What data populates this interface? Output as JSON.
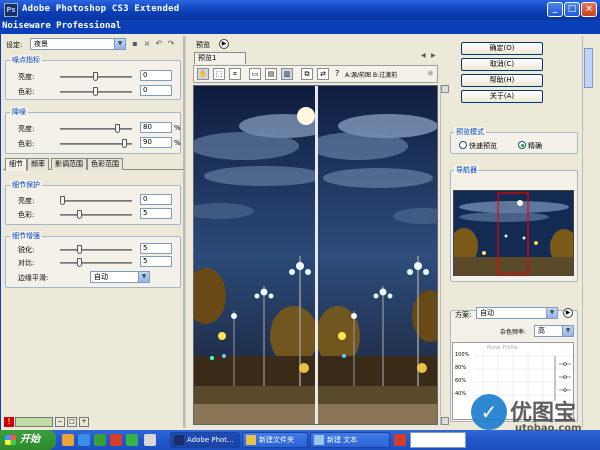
{
  "titlebar": {
    "icon": "Ps",
    "title": "Adobe Photoshop CS3 Extended",
    "minimize": "_",
    "maximize": "□",
    "close": "×"
  },
  "plugin_title": "Noiseware Professional",
  "settings": {
    "label": "设定:",
    "value": "夜景"
  },
  "brightness_group": {
    "title": "噪点指标",
    "luminance_label": "亮度:",
    "luminance_value": "0",
    "color_label": "色彩:",
    "color_value": "0"
  },
  "noise_reduction": {
    "title": "降噪",
    "luminance_label": "亮度:",
    "luminance_value": "80",
    "luminance_level": 0.8,
    "color_label": "色彩:",
    "color_value": "90",
    "color_level": 0.9,
    "unit": "%"
  },
  "tabs": [
    "细节",
    "频率",
    "影调范围",
    "色彩范围"
  ],
  "detail_protect": {
    "title": "细节保护",
    "luminance_label": "亮度:",
    "luminance_value": "0",
    "color_label": "色彩:",
    "color_value": "5"
  },
  "detail_enhance": {
    "title": "细节增强",
    "sharpen_label": "锐化:",
    "sharpen_value": "5",
    "contrast_label": "对比:",
    "contrast_value": "5",
    "smooth_label": "边缘平滑:",
    "smooth_value": "自动"
  },
  "preview": {
    "label": "预览",
    "tab": "预览1",
    "toolbar_text": "A:源/前图 B:过渡前",
    "help": "?"
  },
  "buttons": {
    "ok": "确定(O)",
    "cancel": "取消(C)",
    "help": "帮助(H)",
    "about": "关于(A)"
  },
  "preview_mode": {
    "title": "预览模式",
    "fast": "快速预览",
    "accurate": "精确",
    "selected": "accurate"
  },
  "navigator": {
    "title": "导航器"
  },
  "scheme": {
    "label": "方案:",
    "value": "自动",
    "sub_label": "杂色频率:",
    "sub_value": "高",
    "graph_title": "Noise Profile",
    "y_ticks": [
      "100%",
      "80%",
      "60%",
      "40%"
    ]
  },
  "taskbar": {
    "start": "开始",
    "tasks": [
      "Adobe Phot...",
      "新建文件夹",
      "新建 文本"
    ],
    "active_task": 0
  },
  "watermark": {
    "logo": "✓",
    "text": "优图宝",
    "url": "utobao.com"
  },
  "colors": {
    "title_blue": "#0b3fb7",
    "group_title": "#0046d5",
    "start_green": "#2e8b2e"
  }
}
